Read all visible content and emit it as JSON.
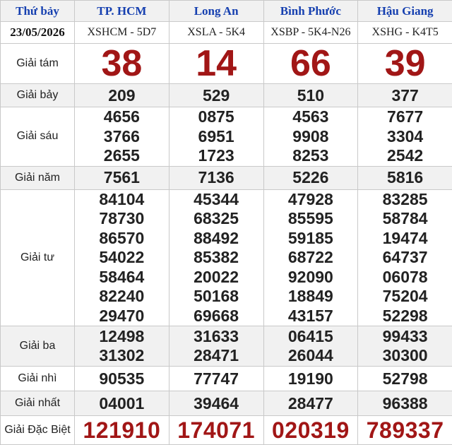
{
  "header": {
    "day_label": "Thứ bảy",
    "date": "23/05/2026",
    "provinces": [
      {
        "name": "TP. HCM",
        "code": "XSHCM - 5D7"
      },
      {
        "name": "Long An",
        "code": "XSLA - 5K4"
      },
      {
        "name": "Bình Phước",
        "code": "XSBP - 5K4-N26"
      },
      {
        "name": "Hậu Giang",
        "code": "XSHG - K4T5"
      }
    ]
  },
  "prizes": {
    "g8": {
      "label": "Giải tám",
      "values": [
        "38",
        "14",
        "66",
        "39"
      ]
    },
    "g7": {
      "label": "Giải bảy",
      "values": [
        "209",
        "529",
        "510",
        "377"
      ]
    },
    "g6": {
      "label": "Giải sáu",
      "values": [
        [
          "4656",
          "3766",
          "2655"
        ],
        [
          "0875",
          "6951",
          "1723"
        ],
        [
          "4563",
          "9908",
          "8253"
        ],
        [
          "7677",
          "3304",
          "2542"
        ]
      ]
    },
    "g5": {
      "label": "Giải năm",
      "values": [
        "7561",
        "7136",
        "5226",
        "5816"
      ]
    },
    "g4": {
      "label": "Giải tư",
      "values": [
        [
          "84104",
          "78730",
          "86570",
          "54022",
          "58464",
          "82240",
          "29470"
        ],
        [
          "45344",
          "68325",
          "88492",
          "85382",
          "20022",
          "50168",
          "69668"
        ],
        [
          "47928",
          "85595",
          "59185",
          "68722",
          "92090",
          "18849",
          "43157"
        ],
        [
          "83285",
          "58784",
          "19474",
          "64737",
          "06078",
          "75204",
          "52298"
        ]
      ]
    },
    "g3": {
      "label": "Giải ba",
      "values": [
        [
          "12498",
          "31302"
        ],
        [
          "31633",
          "28471"
        ],
        [
          "06415",
          "26044"
        ],
        [
          "99433",
          "30300"
        ]
      ]
    },
    "g2": {
      "label": "Giải nhì",
      "values": [
        "90535",
        "77747",
        "19190",
        "52798"
      ]
    },
    "g1": {
      "label": "Giải nhất",
      "values": [
        "04001",
        "39464",
        "28477",
        "96388"
      ]
    },
    "db": {
      "label": "Giải Đặc Biệt",
      "values": [
        "121910",
        "174071",
        "020319",
        "789337"
      ]
    }
  },
  "colors": {
    "header_blue": "#1640b0",
    "prize_red": "#a11616",
    "shade": "#f1f1f1"
  }
}
